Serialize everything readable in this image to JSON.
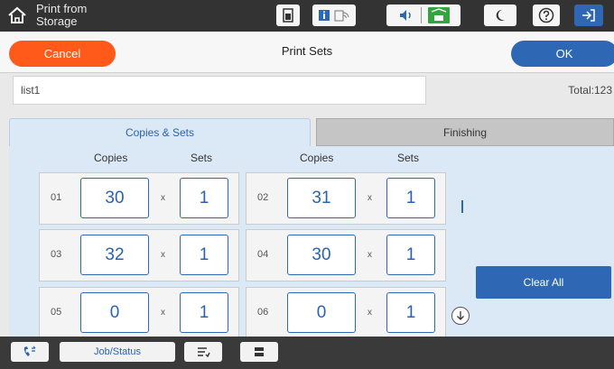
{
  "header": {
    "home_title": "Print from\nStorage"
  },
  "toolbar_icons": [
    "ink-icon",
    "info-icon",
    "wifi-icon",
    "sound-icon",
    "ethernet-icon",
    "sleep-icon",
    "help-icon",
    "logout-icon"
  ],
  "title_bar": {
    "cancel_label": "Cancel",
    "title": "Print Sets",
    "ok_label": "OK"
  },
  "name_field": {
    "value": "list1"
  },
  "total": "Total:123",
  "tabs": [
    {
      "label": "Copies & Sets",
      "active": true
    },
    {
      "label": "Finishing",
      "active": false
    }
  ],
  "column_headers": {
    "copies": "Copies",
    "sets": "Sets"
  },
  "multiply_symbol": "x",
  "rows": [
    {
      "num": "01",
      "copies": "30",
      "sets": "1"
    },
    {
      "num": "02",
      "copies": "31",
      "sets": "1"
    },
    {
      "num": "03",
      "copies": "32",
      "sets": "1"
    },
    {
      "num": "04",
      "copies": "30",
      "sets": "1"
    },
    {
      "num": "05",
      "copies": "0",
      "sets": "1"
    },
    {
      "num": "06",
      "copies": "0",
      "sets": "1"
    }
  ],
  "clear_all_label": "Clear All",
  "bottom_bar": {
    "job_status_label": "Job/Status"
  },
  "colors": {
    "accent_blue": "#2e68b5",
    "cancel_orange": "#ff5a1a",
    "tab_active_bg": "#dbe8f5"
  }
}
